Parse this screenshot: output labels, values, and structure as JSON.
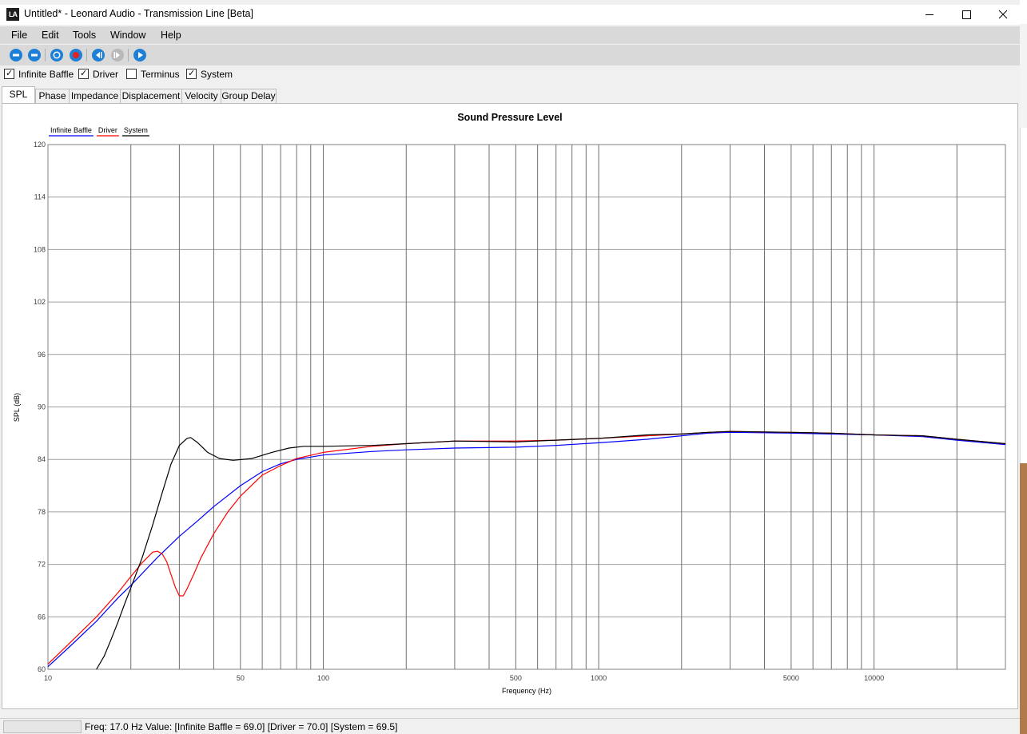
{
  "window": {
    "title": "Untitled* - Leonard Audio - Transmission Line [Beta]",
    "logo_text": "LA"
  },
  "menu": [
    "File",
    "Edit",
    "Tools",
    "Window",
    "Help"
  ],
  "toolbar": {
    "buttons": [
      "new-icon",
      "open-icon",
      "record-stop-icon",
      "record-icon",
      "step-back-icon",
      "step-forward-icon",
      "play-icon"
    ],
    "accent_color": "#1e7fd6"
  },
  "checkboxes": [
    {
      "label": "Infinite Baffle",
      "checked": true
    },
    {
      "label": "Driver",
      "checked": true
    },
    {
      "label": "Terminus",
      "checked": false
    },
    {
      "label": "System",
      "checked": true
    }
  ],
  "tabs": [
    "SPL",
    "Phase",
    "Impedance",
    "Displacement",
    "Velocity",
    "Group Delay"
  ],
  "active_tab": "SPL",
  "chart_data": {
    "type": "line",
    "title": "Sound Pressure Level",
    "xlabel": "Frequency (Hz)",
    "ylabel": "SPL (dB)",
    "xscale": "log",
    "xlim": [
      10,
      30000
    ],
    "ylim": [
      60,
      120
    ],
    "xticks": [
      {
        "value": 10,
        "label": "10"
      },
      {
        "value": 50,
        "label": "50"
      },
      {
        "value": 100,
        "label": "100"
      },
      {
        "value": 500,
        "label": "500"
      },
      {
        "value": 1000,
        "label": "1000"
      },
      {
        "value": 5000,
        "label": "5000"
      },
      {
        "value": 10000,
        "label": "10000"
      }
    ],
    "yticks": [
      60,
      66,
      72,
      78,
      84,
      90,
      96,
      102,
      108,
      114,
      120
    ],
    "grid": true,
    "legend_position": "top-left",
    "series": [
      {
        "name": "Infinite Baffle",
        "color": "#0000ff",
        "points": [
          [
            10,
            60.3
          ],
          [
            12,
            62.6
          ],
          [
            15,
            65.5
          ],
          [
            18,
            68.2
          ],
          [
            20,
            69.6
          ],
          [
            25,
            72.8
          ],
          [
            30,
            75.2
          ],
          [
            35,
            77.0
          ],
          [
            40,
            78.6
          ],
          [
            50,
            81.0
          ],
          [
            60,
            82.6
          ],
          [
            70,
            83.5
          ],
          [
            80,
            84.0
          ],
          [
            100,
            84.5
          ],
          [
            150,
            84.9
          ],
          [
            200,
            85.1
          ],
          [
            300,
            85.3
          ],
          [
            500,
            85.4
          ],
          [
            700,
            85.6
          ],
          [
            1000,
            85.9
          ],
          [
            1500,
            86.3
          ],
          [
            2000,
            86.7
          ],
          [
            2500,
            87.0
          ],
          [
            3000,
            87.1
          ],
          [
            5000,
            87.0
          ],
          [
            7000,
            86.9
          ],
          [
            10000,
            86.8
          ],
          [
            15000,
            86.6
          ],
          [
            20000,
            86.2
          ],
          [
            30000,
            85.7
          ]
        ]
      },
      {
        "name": "Driver",
        "color": "#ff0000",
        "points": [
          [
            10,
            60.6
          ],
          [
            12,
            63.0
          ],
          [
            15,
            66.0
          ],
          [
            18,
            68.8
          ],
          [
            20,
            70.6
          ],
          [
            22,
            72.2
          ],
          [
            24,
            73.4
          ],
          [
            25,
            73.5
          ],
          [
            26,
            73.2
          ],
          [
            27,
            72.3
          ],
          [
            28,
            70.8
          ],
          [
            29,
            69.4
          ],
          [
            30,
            68.4
          ],
          [
            31,
            68.4
          ],
          [
            32,
            69.2
          ],
          [
            34,
            71.0
          ],
          [
            36,
            72.8
          ],
          [
            40,
            75.5
          ],
          [
            45,
            78.0
          ],
          [
            50,
            79.8
          ],
          [
            60,
            82.2
          ],
          [
            70,
            83.3
          ],
          [
            80,
            84.1
          ],
          [
            100,
            84.8
          ],
          [
            150,
            85.5
          ],
          [
            200,
            85.8
          ],
          [
            300,
            86.1
          ],
          [
            500,
            86.1
          ],
          [
            700,
            86.2
          ],
          [
            1000,
            86.4
          ],
          [
            1500,
            86.7
          ],
          [
            2000,
            86.9
          ],
          [
            2500,
            87.1
          ],
          [
            3000,
            87.2
          ],
          [
            5000,
            87.1
          ],
          [
            7000,
            87.0
          ],
          [
            10000,
            86.8
          ],
          [
            15000,
            86.7
          ],
          [
            20000,
            86.3
          ],
          [
            30000,
            85.8
          ]
        ]
      },
      {
        "name": "System",
        "color": "#000000",
        "points": [
          [
            15,
            60.0
          ],
          [
            16,
            61.5
          ],
          [
            17,
            63.5
          ],
          [
            18,
            65.5
          ],
          [
            19,
            67.5
          ],
          [
            20,
            69.3
          ],
          [
            22,
            72.8
          ],
          [
            24,
            76.5
          ],
          [
            26,
            80.2
          ],
          [
            28,
            83.5
          ],
          [
            30,
            85.6
          ],
          [
            32,
            86.4
          ],
          [
            33,
            86.5
          ],
          [
            35,
            85.9
          ],
          [
            38,
            84.8
          ],
          [
            42,
            84.1
          ],
          [
            47,
            83.9
          ],
          [
            55,
            84.1
          ],
          [
            65,
            84.8
          ],
          [
            75,
            85.3
          ],
          [
            85,
            85.5
          ],
          [
            100,
            85.5
          ],
          [
            150,
            85.6
          ],
          [
            200,
            85.8
          ],
          [
            300,
            86.1
          ],
          [
            500,
            86.0
          ],
          [
            700,
            86.2
          ],
          [
            1000,
            86.4
          ],
          [
            1500,
            86.8
          ],
          [
            2000,
            86.9
          ],
          [
            2500,
            87.1
          ],
          [
            3000,
            87.2
          ],
          [
            5000,
            87.1
          ],
          [
            7000,
            87.0
          ],
          [
            10000,
            86.8
          ],
          [
            15000,
            86.7
          ],
          [
            20000,
            86.3
          ],
          [
            30000,
            85.8
          ]
        ]
      }
    ]
  },
  "status": {
    "text": "Freq: 17.0 Hz  Value: [Infinite Baffle = 69.0]  [Driver = 70.0]  [System = 69.5]"
  }
}
